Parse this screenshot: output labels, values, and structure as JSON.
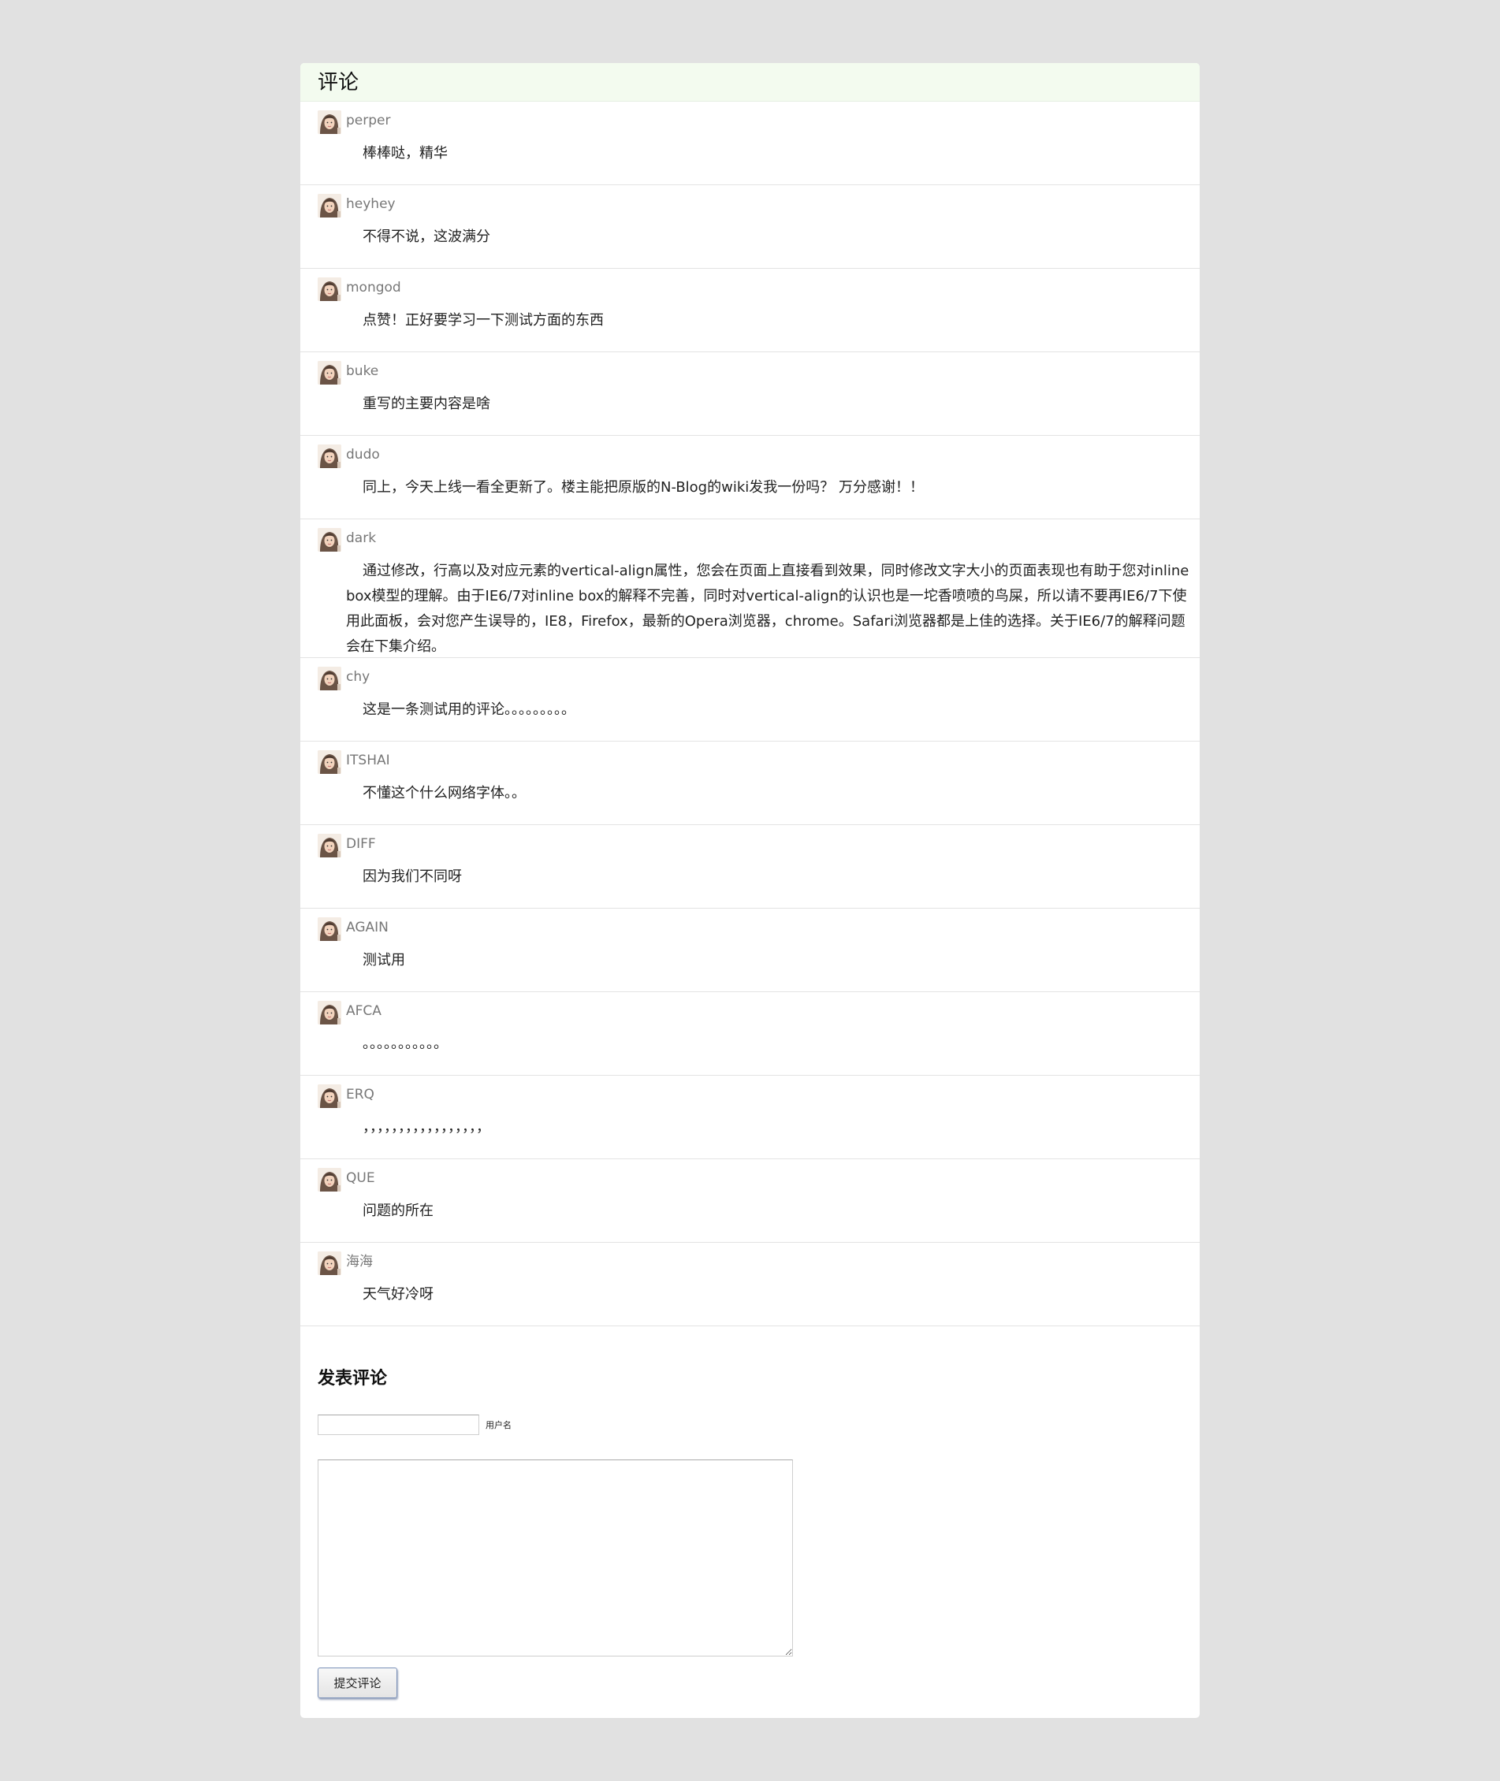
{
  "section": {
    "title": "评论"
  },
  "comments": [
    {
      "author": "perper",
      "text": "棒棒哒，精华"
    },
    {
      "author": "heyhey",
      "text": "不得不说，这波满分"
    },
    {
      "author": "mongod",
      "text": "点赞！正好要学习一下测试方面的东西"
    },
    {
      "author": "buke",
      "text": "重写的主要内容是啥"
    },
    {
      "author": "dudo",
      "text": "同上，今天上线一看全更新了。楼主能把原版的N-Blog的wiki发我一份吗？ 万分感谢！！"
    },
    {
      "author": "dark",
      "text": "通过修改，行高以及对应元素的vertical-align属性，您会在页面上直接看到效果，同时修改文字大小的页面表现也有助于您对inline box模型的理解。由于IE6/7对inline box的解释不完善，同时对vertical-align的认识也是一坨香喷喷的鸟屎，所以请不要再IE6/7下使用此面板，会对您产生误导的，IE8，Firefox，最新的Opera浏览器，chrome。Safari浏览器都是上佳的选择。关于IE6/7的解释问题会在下集介绍。"
    },
    {
      "author": "chy",
      "text": "这是一条测试用的评论。。。。。。。。。"
    },
    {
      "author": "ITSHAI",
      "text": "不懂这个什么网络字体。。"
    },
    {
      "author": "DIFF",
      "text": "因为我们不同呀"
    },
    {
      "author": "AGAIN",
      "text": "测试用"
    },
    {
      "author": "AFCA",
      "text": "。。。。。。。。。。。"
    },
    {
      "author": "ERQ",
      "text": "，，，，，，，，，，，，，，，，，"
    },
    {
      "author": "QUE",
      "text": "问题的所在"
    },
    {
      "author": "海海",
      "text": "天气好冷呀"
    }
  ],
  "compose": {
    "title": "发表评论",
    "username_label": "用户名",
    "username_value": "",
    "content_value": "",
    "submit_label": "提交评论"
  },
  "icons": {
    "avatar": "user-avatar-icon"
  },
  "colors": {
    "page_background": "#e1e1e1",
    "header_background": "#f3fbef",
    "author_text": "#777777",
    "button_border": "#7a90b8"
  }
}
